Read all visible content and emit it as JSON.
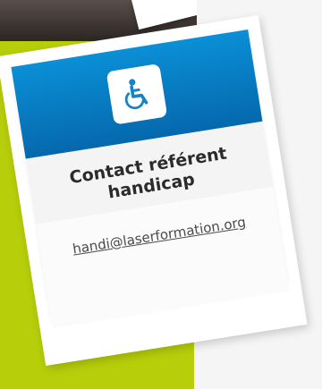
{
  "card": {
    "icon": "wheelchair-accessibility-icon",
    "title": "Contact référent handicap",
    "email": "handi@laserformation.org"
  },
  "colors": {
    "header_blue": "#0878c4",
    "green_background": "#b7cf0a",
    "card_white": "#ffffff"
  }
}
